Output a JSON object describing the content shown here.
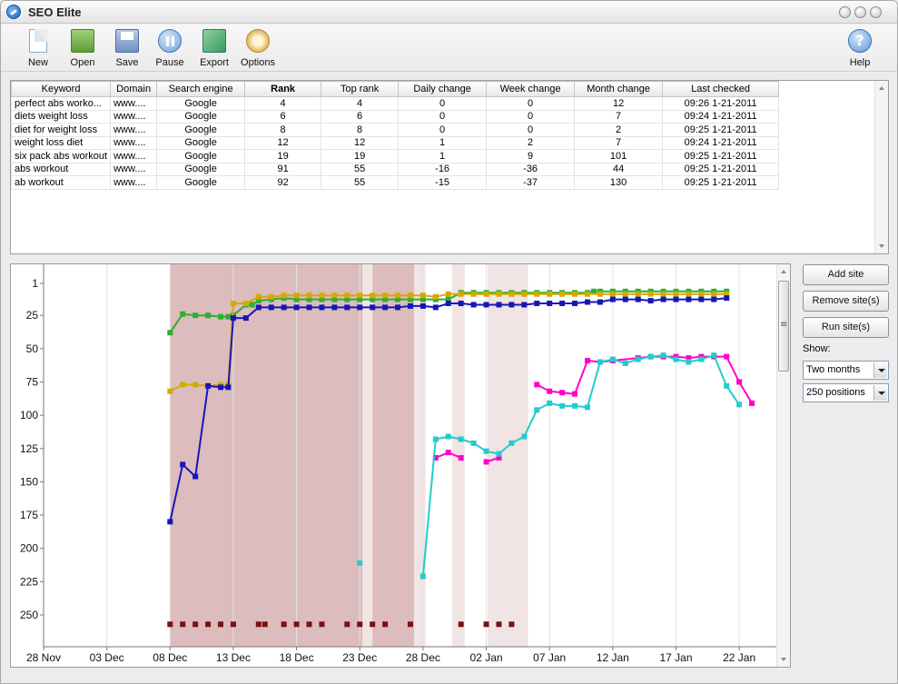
{
  "window": {
    "title": "SEO Elite",
    "app_icon": "seo-elite-logo-icon"
  },
  "toolbar": {
    "buttons": [
      {
        "label": "New",
        "icon": "new-document-icon"
      },
      {
        "label": "Open",
        "icon": "open-folder-icon"
      },
      {
        "label": "Save",
        "icon": "floppy-disk-icon"
      },
      {
        "label": "Pause",
        "icon": "pause-icon"
      },
      {
        "label": "Export",
        "icon": "export-icon"
      },
      {
        "label": "Options",
        "icon": "options-gear-icon"
      }
    ],
    "help_label": "Help"
  },
  "table": {
    "columns": [
      "Keyword",
      "Domain",
      "Search engine",
      "Rank",
      "Top rank",
      "Daily change",
      "Week change",
      "Month change",
      "Last checked"
    ],
    "rows": [
      [
        "perfect abs worko...",
        "www....",
        "Google",
        "4",
        "4",
        "0",
        "0",
        "12",
        "09:26 1-21-2011"
      ],
      [
        "diets weight loss",
        "www....",
        "Google",
        "6",
        "6",
        "0",
        "0",
        "7",
        "09:24 1-21-2011"
      ],
      [
        "diet for weight loss",
        "www....",
        "Google",
        "8",
        "8",
        "0",
        "0",
        "2",
        "09:25 1-21-2011"
      ],
      [
        "weight loss diet",
        "www....",
        "Google",
        "12",
        "12",
        "1",
        "2",
        "7",
        "09:24 1-21-2011"
      ],
      [
        "six pack abs workout",
        "www....",
        "Google",
        "19",
        "19",
        "1",
        "9",
        "101",
        "09:25 1-21-2011"
      ],
      [
        "abs workout",
        "www....",
        "Google",
        "91",
        "55",
        "-16",
        "-36",
        "44",
        "09:25 1-21-2011"
      ],
      [
        "ab workout",
        "www....",
        "Google",
        "92",
        "55",
        "-15",
        "-37",
        "130",
        "09:25 1-21-2011"
      ]
    ]
  },
  "side": {
    "add_site": "Add site",
    "remove_sites": "Remove site(s)",
    "run_sites": "Run site(s)",
    "show_label": "Show:",
    "period_value": "Two months",
    "positions_value": "250 positions"
  },
  "chart_data": {
    "type": "line",
    "y_reversed": true,
    "ylim": [
      1,
      260
    ],
    "y_ticks": [
      1,
      25,
      50,
      75,
      100,
      125,
      150,
      175,
      200,
      225,
      250
    ],
    "x_range_days": [
      0,
      55
    ],
    "x_ticks": [
      {
        "label": "28 Nov",
        "day": 0
      },
      {
        "label": "03 Dec",
        "day": 5
      },
      {
        "label": "08 Dec",
        "day": 10
      },
      {
        "label": "13 Dec",
        "day": 15
      },
      {
        "label": "18 Dec",
        "day": 20
      },
      {
        "label": "23 Dec",
        "day": 25
      },
      {
        "label": "28 Dec",
        "day": 30
      },
      {
        "label": "02 Jan",
        "day": 35
      },
      {
        "label": "07 Jan",
        "day": 40
      },
      {
        "label": "12 Jan",
        "day": 45
      },
      {
        "label": "17 Jan",
        "day": 50
      },
      {
        "label": "22 Jan",
        "day": 55
      }
    ],
    "shaded_periods": [
      {
        "from": 10,
        "to": 25.2,
        "shade": "dark"
      },
      {
        "from": 25.2,
        "to": 26,
        "shade": "light"
      },
      {
        "from": 26,
        "to": 29.3,
        "shade": "dark"
      },
      {
        "from": 29.3,
        "to": 30.2,
        "shade": "light"
      },
      {
        "from": 32.3,
        "to": 33.3,
        "shade": "light"
      },
      {
        "from": 35.1,
        "to": 38.3,
        "shade": "light"
      }
    ],
    "series": [
      {
        "color": "#2fae32",
        "points": [
          [
            10,
            38
          ],
          [
            11,
            24
          ],
          [
            12,
            25
          ],
          [
            13,
            25
          ],
          [
            14,
            26
          ],
          [
            14.6,
            26
          ],
          [
            15,
            25
          ],
          [
            16,
            17
          ],
          [
            16.5,
            17
          ],
          [
            17,
            14
          ],
          [
            18,
            13
          ],
          [
            19,
            12
          ],
          [
            20,
            13
          ],
          [
            21,
            13
          ],
          [
            22,
            13
          ],
          [
            23,
            13
          ],
          [
            24,
            13
          ],
          [
            25,
            13
          ],
          [
            26,
            13
          ],
          [
            27,
            13
          ],
          [
            28,
            13
          ],
          [
            29,
            13
          ],
          [
            30,
            13
          ],
          [
            31,
            13
          ],
          [
            32,
            13
          ],
          [
            33,
            8
          ],
          [
            34,
            8
          ],
          [
            35,
            8
          ],
          [
            36,
            8
          ],
          [
            37,
            8
          ],
          [
            38,
            8
          ],
          [
            39,
            8
          ],
          [
            40,
            8
          ],
          [
            41,
            8
          ],
          [
            42,
            8
          ],
          [
            43,
            8
          ],
          [
            43.5,
            7
          ],
          [
            44,
            7
          ],
          [
            45,
            7
          ],
          [
            46,
            7
          ],
          [
            47,
            7
          ],
          [
            48,
            7
          ],
          [
            49,
            7
          ],
          [
            50,
            7
          ],
          [
            51,
            7
          ],
          [
            52,
            7
          ],
          [
            53,
            7
          ],
          [
            54,
            7
          ]
        ]
      },
      {
        "color": "#d4aa00",
        "points": [
          [
            10,
            82
          ],
          [
            11,
            77
          ],
          [
            12,
            77
          ],
          [
            13,
            78
          ],
          [
            14,
            77
          ],
          [
            14.6,
            77
          ],
          [
            15,
            16
          ],
          [
            16,
            16
          ],
          [
            17,
            11
          ],
          [
            18,
            11
          ],
          [
            19,
            10
          ],
          [
            20,
            10
          ],
          [
            21,
            10
          ],
          [
            22,
            10
          ],
          [
            23,
            10
          ],
          [
            24,
            10
          ],
          [
            25,
            10
          ],
          [
            26,
            10
          ],
          [
            27,
            10
          ],
          [
            28,
            10
          ],
          [
            29,
            10
          ],
          [
            30,
            10
          ],
          [
            31,
            11
          ],
          [
            32,
            9
          ],
          [
            33,
            9
          ],
          [
            34,
            9
          ],
          [
            35,
            9
          ],
          [
            36,
            9
          ],
          [
            37,
            9
          ],
          [
            38,
            9
          ],
          [
            39,
            9
          ],
          [
            40,
            9
          ],
          [
            41,
            9
          ],
          [
            42,
            9
          ],
          [
            43,
            9
          ],
          [
            44,
            9
          ],
          [
            45,
            9
          ],
          [
            46,
            9
          ],
          [
            47,
            9
          ],
          [
            48,
            9
          ],
          [
            49,
            9
          ],
          [
            50,
            9
          ],
          [
            51,
            9
          ],
          [
            52,
            9
          ],
          [
            53,
            9
          ],
          [
            54,
            9
          ]
        ]
      },
      {
        "color": "#1616b8",
        "points": [
          [
            10,
            180
          ],
          [
            11,
            137
          ],
          [
            12,
            146
          ],
          [
            13,
            78
          ],
          [
            14,
            79
          ],
          [
            14.6,
            79
          ],
          [
            15,
            27
          ],
          [
            16,
            27
          ],
          [
            17,
            19
          ],
          [
            18,
            19
          ],
          [
            19,
            19
          ],
          [
            20,
            19
          ],
          [
            21,
            19
          ],
          [
            22,
            19
          ],
          [
            23,
            19
          ],
          [
            24,
            19
          ],
          [
            25,
            19
          ],
          [
            26,
            19
          ],
          [
            27,
            19
          ],
          [
            28,
            19
          ],
          [
            29,
            18
          ],
          [
            30,
            18
          ],
          [
            31,
            19
          ],
          [
            32,
            16
          ],
          [
            33,
            16
          ],
          [
            34,
            17
          ],
          [
            35,
            17
          ],
          [
            36,
            17
          ],
          [
            37,
            17
          ],
          [
            38,
            17
          ],
          [
            39,
            16
          ],
          [
            40,
            16
          ],
          [
            41,
            16
          ],
          [
            42,
            16
          ],
          [
            43,
            15
          ],
          [
            44,
            15
          ],
          [
            45,
            13
          ],
          [
            46,
            13
          ],
          [
            47,
            13
          ],
          [
            48,
            14
          ],
          [
            49,
            13
          ],
          [
            50,
            13
          ],
          [
            51,
            13
          ],
          [
            52,
            13
          ],
          [
            53,
            13
          ],
          [
            54,
            12
          ]
        ]
      },
      {
        "color": "#ff00cc",
        "points": [
          [
            31,
            132
          ],
          [
            32,
            128
          ],
          [
            33,
            132
          ],
          [
            null,
            null
          ],
          [
            35,
            135
          ],
          [
            36,
            132
          ],
          [
            null,
            null
          ],
          [
            39,
            77
          ],
          [
            40,
            82
          ],
          [
            41,
            83
          ],
          [
            42,
            84
          ],
          [
            43,
            59
          ],
          [
            44,
            60
          ],
          [
            45,
            59
          ],
          [
            47,
            57
          ],
          [
            48,
            56
          ],
          [
            49,
            56
          ],
          [
            50,
            56
          ],
          [
            51,
            57
          ],
          [
            52,
            56
          ],
          [
            53,
            56
          ],
          [
            54,
            56
          ],
          [
            55,
            75
          ],
          [
            56,
            91
          ]
        ]
      },
      {
        "color": "#22cccc",
        "points": [
          [
            25,
            211
          ],
          [
            null,
            null
          ],
          [
            30,
            221
          ],
          [
            31,
            118
          ],
          [
            32,
            116
          ],
          [
            33,
            118
          ],
          [
            34,
            121
          ],
          [
            35,
            127
          ],
          [
            36,
            129
          ],
          [
            37,
            121
          ],
          [
            38,
            116
          ],
          [
            39,
            96
          ],
          [
            40,
            91
          ],
          [
            41,
            93
          ],
          [
            42,
            93
          ],
          [
            43,
            94
          ],
          [
            44,
            60
          ],
          [
            45,
            58
          ],
          [
            46,
            61
          ],
          [
            47,
            58
          ],
          [
            48,
            56
          ],
          [
            49,
            55
          ],
          [
            50,
            58
          ],
          [
            51,
            60
          ],
          [
            52,
            58
          ],
          [
            53,
            55
          ],
          [
            54,
            78
          ],
          [
            55,
            92
          ]
        ]
      },
      {
        "color": "#7a1010",
        "markers_only": true,
        "points": [
          [
            10,
            257
          ],
          [
            11,
            257
          ],
          [
            12,
            257
          ],
          [
            13,
            257
          ],
          [
            14,
            257
          ],
          [
            15,
            257
          ],
          [
            17,
            257
          ],
          [
            17.5,
            257
          ],
          [
            19,
            257
          ],
          [
            20,
            257
          ],
          [
            21,
            257
          ],
          [
            22,
            257
          ],
          [
            24,
            257
          ],
          [
            25,
            257
          ],
          [
            26,
            257
          ],
          [
            27,
            257
          ],
          [
            29,
            257
          ],
          [
            33,
            257
          ],
          [
            35,
            257
          ],
          [
            36,
            257
          ],
          [
            37,
            257
          ]
        ]
      }
    ]
  }
}
